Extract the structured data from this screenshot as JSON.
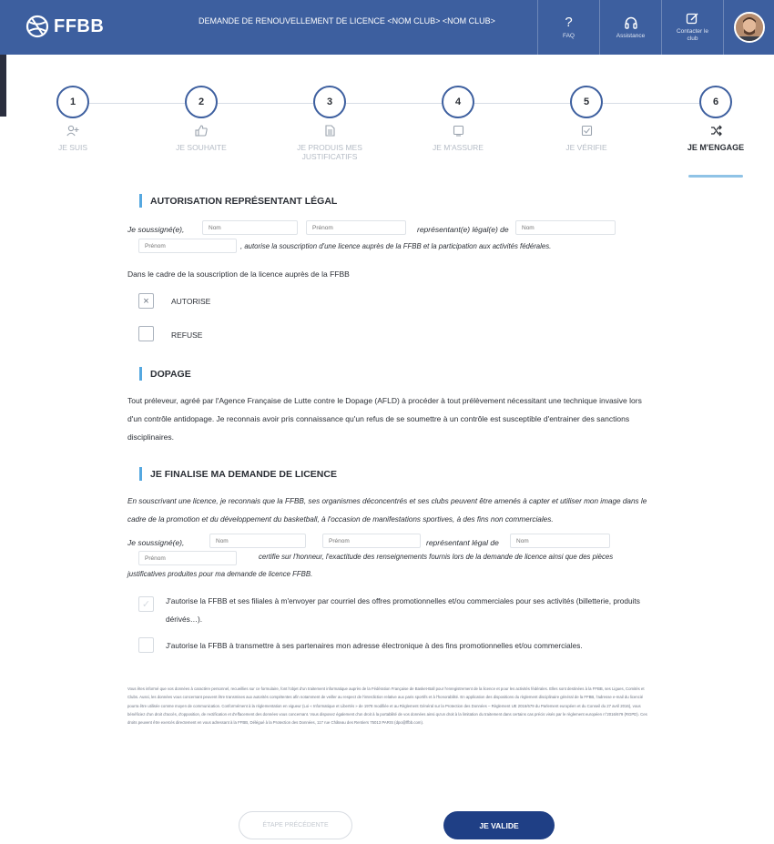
{
  "header": {
    "logo_text": "FFBB",
    "title": "DEMANDE DE RENOUVELLEMENT DE LICENCE <NOM CLUB> <NOM CLUB>",
    "faq_label": "FAQ",
    "faq_icon": "?",
    "assistance_label": "Assistance",
    "contact_label": "Contacter le club"
  },
  "steps": [
    {
      "number": "1",
      "label": "JE SUIS",
      "icon": "user-plus-icon"
    },
    {
      "number": "2",
      "label": "JE SOUHAITE",
      "icon": "thumbs-up-icon"
    },
    {
      "number": "3",
      "label": "JE PRODUIS MES JUSTIFICATIFS",
      "icon": "document-icon"
    },
    {
      "number": "4",
      "label": "JE M'ASSURE",
      "icon": "square-icon"
    },
    {
      "number": "5",
      "label": "JE VÉRIFIE",
      "icon": "check-square-icon"
    },
    {
      "number": "6",
      "label": "JE M'ENGAGE",
      "icon": "shuffle-icon"
    }
  ],
  "section_legal_rep": {
    "title": "AUTORISATION REPRÉSENTANT LÉGAL",
    "soussigne": "Je soussigné(e),",
    "nom_placeholder": "Nom",
    "prenom_placeholder": "Prénom",
    "representant": "représentant(e) légal(e) de",
    "nom2_placeholder": "Nom",
    "prenom2_placeholder": "Prénom",
    "autorise_text": ", autorise la souscription d'une licence auprès de la FFBB et la participation aux activités fédérales.",
    "context": "Dans le cadre de la souscription de la licence auprès de la FFBB",
    "option_autorise": "AUTORISE",
    "option_refuse": "REFUSE"
  },
  "section_dopage": {
    "title": "DOPAGE",
    "text": "Tout préleveur, agréé par l'Agence Française de Lutte contre le Dopage (AFLD) à procéder à tout prélèvement nécessitant une technique invasive lors d'un contrôle antidopage. Je reconnais avoir pris connaissance qu'un refus de se soumettre à un contrôle est susceptible d'entrainer des sanctions disciplinaires."
  },
  "section_finalise": {
    "title": "JE FINALISE MA DEMANDE DE LICENCE",
    "intro": "En souscrivant une licence, je reconnais que la FFBB, ses organismes déconcentrés et ses clubs peuvent être amenés à capter et utiliser mon image dans le cadre de la promotion et du développement du basketball, à l'occasion de manifestations sportives, à des fins non commerciales.",
    "soussigne": "Je soussigné(e),",
    "nom_placeholder": "Nom",
    "prenom_placeholder": "Prénom",
    "representant": "représentant légal de",
    "nom2_placeholder": "Nom",
    "prenom2_placeholder": "Prénom",
    "certifie": "certifie sur l'honneur, l'exactitude des renseignements fournis lors de la demande de licence ainsi que des pièces justificatives produites  pour ma demande de licence FFBB.",
    "consent_1": "J'autorise la FFBB et ses filiales à m'envoyer par courriel des offres promotionnelles et/ou commerciales pour ses activités (billetterie, produits dérivés…).",
    "consent_2": "J'autorise la FFBB à transmettre à ses partenaires mon adresse électronique à des fins promotionnelles et/ou commerciales."
  },
  "legal_notice": "Vous êtes informé que vos données à caractère personnel, recueillies sur ce formulaire, font l'objet d'un traitement informatique auprès de la Fédération Française de Basket-Ball pour l'enregistrement de la licence et pour les activités fédérales. Elles sont destinées à la FFBB, ses Ligues, Comités et Clubs. Aussi, les données vous concernant peuvent être transmises aux autorités compétentes afin notamment de veiller au respect de l'interdiction relative aux paris sportifs et à l'honorabilité. En application des dispositions du règlement disciplinaire général de la FFBB, l'adresse e-mail du licencié pourra être utilisée comme moyen de communication. Conformément à la réglementation en vigueur (Loi « Informatique et Libertés » de 1978 modifiée et au Règlement Général sur la Protection des Données – Règlement UE 2016/679 du Parlement européen et du Conseil du 27 avril 2016), vous bénéficiez d'un droit d'accès, d'opposition, de rectification et d'effacement des données vous concernant. Vous disposez également d'un droit à la portabilité de vos données ainsi qu'un droit à la limitation du traitement dans certains cas précis visés par le règlement européen n°2016/679 (RGPD). Ces droits peuvent être exercés directement en vous adressant à la FFBB, Délégué à la Protection des Données, 117 rue Château des Rentiers 75013 PARIS (dpo@ffbb.com).",
  "buttons": {
    "prev": "ÉTAPE PRÉCÉDENTE",
    "next": "JE VALIDE"
  },
  "colors": {
    "header": "#3d5f9f",
    "accent": "#55a8e0",
    "primary_button": "#1f3f85"
  }
}
